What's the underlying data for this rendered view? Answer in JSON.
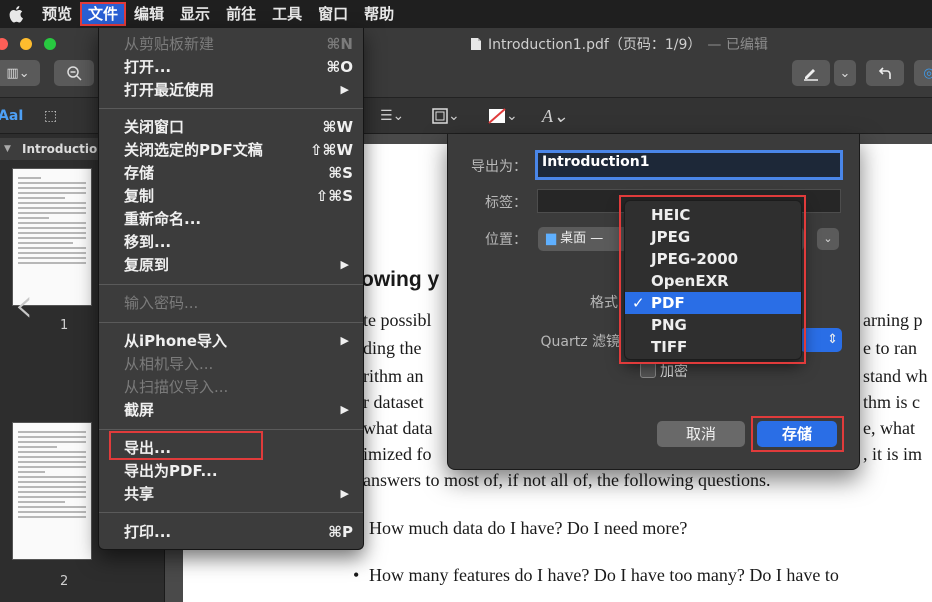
{
  "menubar": {
    "items": [
      "预览",
      "文件",
      "编辑",
      "显示",
      "前往",
      "工具",
      "窗口",
      "帮助"
    ]
  },
  "window": {
    "title": "Introduction1.pdf（页码：1/9）",
    "title_suffix": "— 已编辑"
  },
  "sidebar": {
    "header": "Introduction",
    "pages": [
      "1",
      "2"
    ]
  },
  "file_menu": {
    "items": [
      {
        "label": "从剪贴板新建",
        "shortcut": "⌘N",
        "disabled": true
      },
      {
        "label": "打开...",
        "shortcut": "⌘O"
      },
      {
        "label": "打开最近使用",
        "submenu": "▶"
      },
      {
        "label": "关闭窗口",
        "shortcut": "⌘W"
      },
      {
        "label": "关闭选定的PDF文稿",
        "shortcut": "⇧⌘W"
      },
      {
        "label": "存储",
        "shortcut": "⌘S"
      },
      {
        "label": "复制",
        "shortcut": "⇧⌘S"
      },
      {
        "label": "重新命名..."
      },
      {
        "label": "移到..."
      },
      {
        "label": "复原到",
        "submenu": "▶"
      },
      {
        "label": "输入密码...",
        "disabled": true
      },
      {
        "label": "从iPhone导入",
        "submenu": "▶"
      },
      {
        "label": "从相机导入...",
        "disabled": true
      },
      {
        "label": "从扫描仪导入...",
        "disabled": true
      },
      {
        "label": "截屏",
        "submenu": "▶"
      },
      {
        "label": "导出..."
      },
      {
        "label": "导出为PDF..."
      },
      {
        "label": "共享",
        "submenu": "▶"
      },
      {
        "label": "打印...",
        "shortcut": "⌘P"
      }
    ]
  },
  "export_sheet": {
    "export_as_label": "导出为：",
    "export_as_value": "Introduction1",
    "tags_label": "标签：",
    "location_label": "位置：",
    "location_value": "桌面 —",
    "format_label": "格式",
    "quartz_label": "Quartz 滤镜",
    "encrypt_label": "加密",
    "cancel_label": "取消",
    "save_label": "存储"
  },
  "format_options": {
    "items": [
      "HEIC",
      "JPEG",
      "JPEG-2000",
      "OpenEXR",
      "PDF",
      "PNG",
      "TIFF"
    ],
    "selected": "PDF",
    "check": "✓"
  },
  "document": {
    "heading": "owing y",
    "lines": [
      "te possibl",
      "ding the",
      "rithm an",
      "r dataset",
      "what data",
      "imized fo",
      "answers to most of, if not all of, the following questions."
    ],
    "right_fragments": [
      "arning p",
      "e to ran",
      "stand wh",
      "thm is c",
      "e, what",
      ", it is im"
    ],
    "bullets": [
      "How much data do I have? Do I need more?",
      "How many features do I have? Do I have too many? Do I have to"
    ]
  },
  "colors": {
    "accent": "#2a6ee6",
    "highlight_border": "#e03b3b"
  }
}
